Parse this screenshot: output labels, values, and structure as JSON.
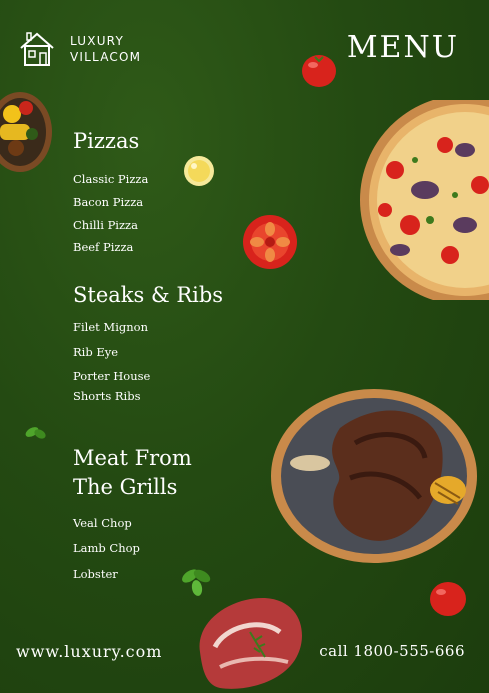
{
  "brand": {
    "line1": "LUXURY",
    "line2": "VILLACOM",
    "logo_icon": "house-icon"
  },
  "header": {
    "title": "MENU"
  },
  "sections": [
    {
      "title": "Pizzas",
      "items": [
        "Classic Pizza",
        "Bacon Pizza",
        "Chilli Pizza",
        "Beef Pizza"
      ]
    },
    {
      "title": "Steaks & Ribs",
      "items": [
        "Filet Mignon",
        "Rib Eye",
        "Porter House",
        "Shorts Ribs"
      ]
    },
    {
      "title_line1": "Meat From",
      "title_line2": "The Grills",
      "items": [
        "Veal Chop",
        "Lamb Chop",
        "Lobster"
      ]
    }
  ],
  "footer": {
    "website": "www.luxury.com",
    "phone": "call 1800-555-666"
  },
  "colors": {
    "background": "#244a12",
    "text": "#ffffff",
    "tomato": "#d8231c",
    "plate_wood": "#c98a4a"
  }
}
